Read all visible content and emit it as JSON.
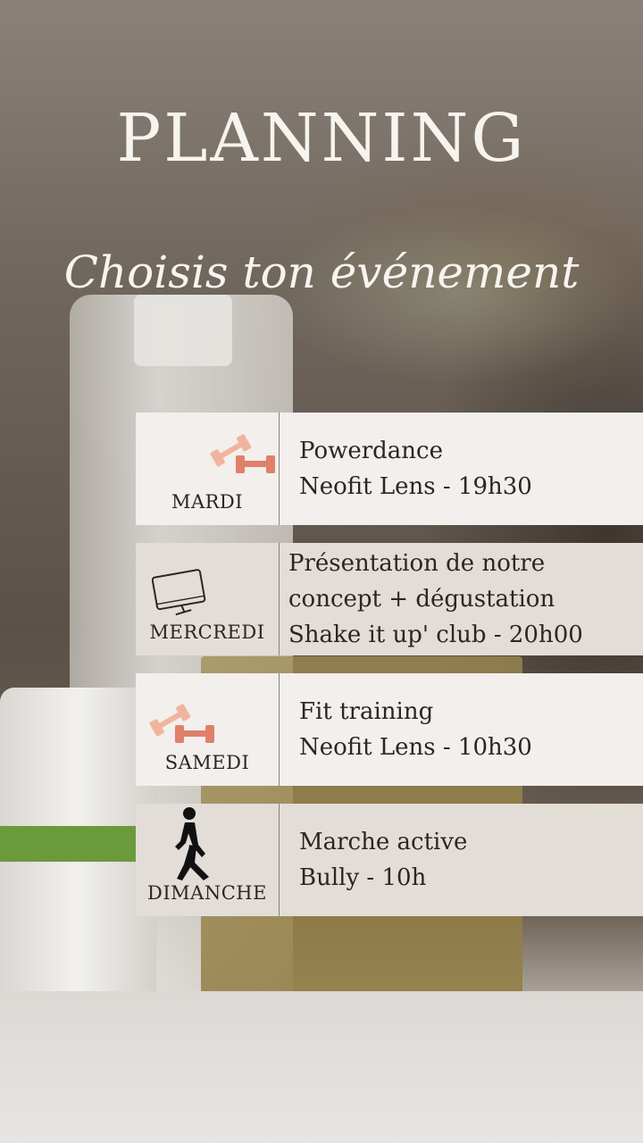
{
  "header": {
    "title": "PLANNING",
    "subtitle": "Choisis ton événement"
  },
  "events": [
    {
      "day": "MARDI",
      "icon": "dumbbell-icon",
      "line1": "Powerdance",
      "line2": "Neofit Lens - 19h30"
    },
    {
      "day": "MERCREDI",
      "icon": "monitor-icon",
      "line1": "Présentation de notre",
      "line2": "concept + dégustation",
      "line3": "Shake it up' club - 20h00"
    },
    {
      "day": "SAMEDI",
      "icon": "dumbbell-icon",
      "line1": "Fit training",
      "line2": "Neofit Lens - 10h30"
    },
    {
      "day": "DIMANCHE",
      "icon": "walking-person-icon",
      "line1": "Marche active",
      "line2": "Bully - 10h"
    }
  ],
  "colors": {
    "dumbbell_light": "#f0b49e",
    "dumbbell_dark": "#e0806a",
    "row_light": "#f2efec",
    "row_dark": "#e2ddd7"
  }
}
